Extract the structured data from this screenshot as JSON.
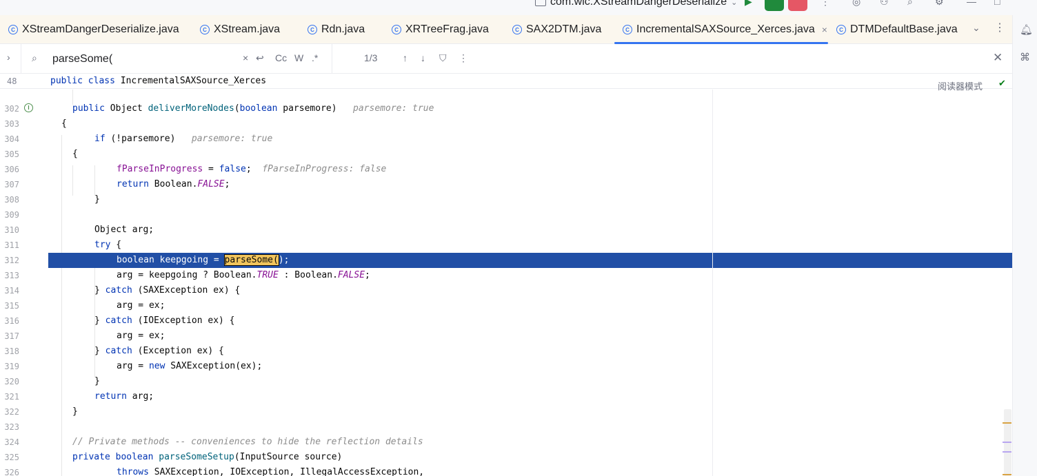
{
  "titlebar": {
    "project_name": "com.wlc.XStreamDangerDeserialize"
  },
  "tabs": [
    {
      "label": "XStreamDangerDeserialize.java",
      "active": false
    },
    {
      "label": "XStream.java",
      "active": false
    },
    {
      "label": "Rdn.java",
      "active": false
    },
    {
      "label": "XRTreeFrag.java",
      "active": false
    },
    {
      "label": "SAX2DTM.java",
      "active": false
    },
    {
      "label": "IncrementalSAXSource_Xerces.java",
      "active": true
    },
    {
      "label": "DTMDefaultBase.java",
      "active": false
    }
  ],
  "find": {
    "query": "parseSome(",
    "match_case_label": "Cc",
    "words_label": "W",
    "regex_label": ".*",
    "counter": "1/3"
  },
  "breadcrumb": {
    "line_number": "48",
    "text": "public class IncrementalSAXSource_Xerces"
  },
  "reader_mode": "阅读器模式",
  "gutter": {
    "line_numbers": [
      "302",
      "303",
      "304",
      "305",
      "306",
      "307",
      "308",
      "309",
      "310",
      "311",
      "312",
      "313",
      "314",
      "315",
      "316",
      "317",
      "318",
      "319",
      "320",
      "321",
      "322",
      "323",
      "324",
      "325",
      "326"
    ]
  },
  "code": {
    "l302": {
      "kw": "public",
      "type": "Object",
      "name": "deliverMoreNodes",
      "args_open": "(",
      "kw2": "boolean",
      "rest": " parsemore)",
      "hint": "parsemore: true"
    },
    "l303": "{",
    "l304": {
      "kw": "if",
      "rest": " (!parsemore)",
      "hint": "parsemore: true"
    },
    "l305": "{",
    "l306": {
      "field": "fParseInProgress",
      "eq": " = ",
      "kw": "false",
      "end": ";",
      "hint": "fParseInProgress: false"
    },
    "l307": {
      "kw": "return",
      "cls": " Boolean.",
      "const": "FALSE",
      "end": ";"
    },
    "l308": "}",
    "l310": "Object arg;",
    "l311": {
      "kw": "try",
      "rest": " {"
    },
    "l312": {
      "kw": "boolean",
      "mid": " keepgoing = ",
      "match": "parseSome(",
      "end": ");"
    },
    "l313": {
      "pre": "arg = keepgoing ? Boolean.",
      "c1": "TRUE",
      "mid": " : Boolean.",
      "c2": "FALSE",
      "end": ";"
    },
    "l314": {
      "pre": "} ",
      "kw": "catch",
      "rest": " (SAXException ex) {"
    },
    "l315": "arg = ex;",
    "l316": {
      "pre": "} ",
      "kw": "catch",
      "rest": " (IOException ex) {"
    },
    "l317": "arg = ex;",
    "l318": {
      "pre": "} ",
      "kw": "catch",
      "rest": " (Exception ex) {"
    },
    "l319": {
      "pre": "arg = ",
      "kw": "new",
      "rest": " SAXException(ex);"
    },
    "l320": "}",
    "l321": {
      "kw": "return",
      "rest": " arg;"
    },
    "l322": "}",
    "l324": "// Private methods -- conveniences to hide the reflection details",
    "l325": {
      "kw": "private",
      "kw2": "boolean",
      "name": "parseSomeSetup",
      "rest": "(InputSource source)"
    },
    "l326": {
      "kw": "throws",
      "rest": " SAXException, IOException, IllegalAccessException,"
    }
  }
}
